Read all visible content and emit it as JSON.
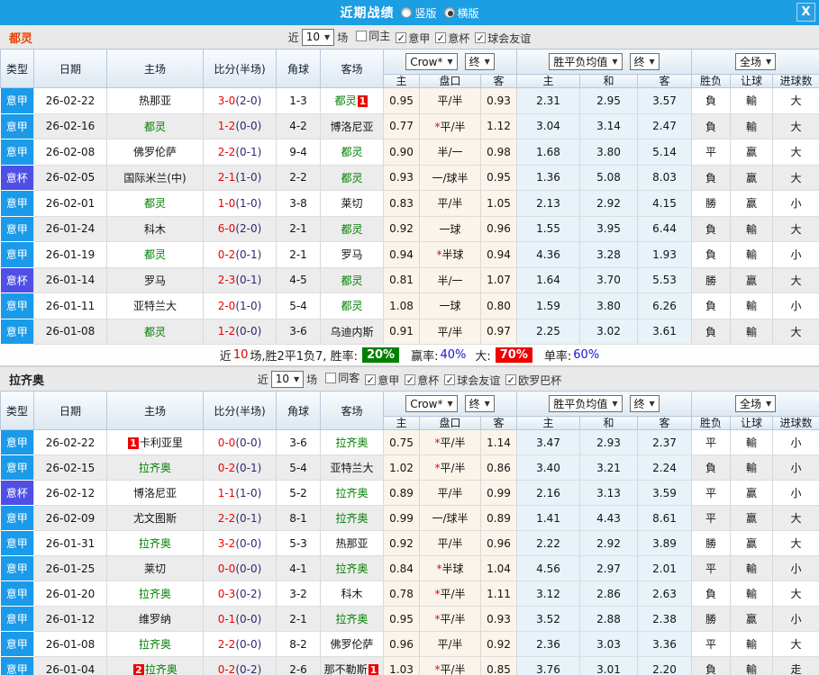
{
  "titlebar": {
    "title": "近期战绩",
    "vertical_label": "竖版",
    "vertical_selected": false,
    "horizontal_label": "横版",
    "horizontal_selected": true,
    "close_label": "X"
  },
  "columns": {
    "type": "类型",
    "date": "日期",
    "home": "主场",
    "score": "比分(半场)",
    "corners": "角球",
    "away": "客场",
    "odds_source": "Crow*",
    "final": "终",
    "avg_source": "胜平负均值",
    "scope": "全场",
    "home_odds": "主",
    "handicap": "盘口",
    "away_odds": "客",
    "avg_win": "主",
    "avg_draw": "和",
    "avg_lose": "客",
    "result": "胜负",
    "handicap_result": "让球",
    "goals": "进球数"
  },
  "colors": {
    "titlebar": "#1b9ee2",
    "league_badge": "#1a9ae8",
    "cup_badge": "#4f4fe6",
    "result_win": "#e00000",
    "result_draw": "#1616d0",
    "result_lose": "#008000",
    "score": "#f00000",
    "half_score": "#2a2a72",
    "focus_team": "#008000",
    "badge_red": "#ee0000",
    "odds_bg": "#faf4ea",
    "avg_bg": "#e7f2f9",
    "rate_win_bg": "#008000",
    "rate_over_bg": "#f00000"
  },
  "sections": [
    {
      "team": "都灵",
      "team_color": "#e84200",
      "filter": {
        "near_label": "近",
        "games": "10",
        "games_suffix": "场",
        "checkboxes": [
          {
            "name": "same-home",
            "label": "同主",
            "checked": false
          },
          {
            "name": "serie-a",
            "label": "意甲",
            "checked": true
          },
          {
            "name": "coppa-italia",
            "label": "意杯",
            "checked": true
          },
          {
            "name": "club-friendly",
            "label": "球会友谊",
            "checked": true
          }
        ]
      },
      "rows": [
        {
          "type": [
            "意甲",
            "league"
          ],
          "date": "26-02-22",
          "home": {
            "n": "热那亚"
          },
          "score": [
            "3-0",
            "(2-0)"
          ],
          "corner": "1-3",
          "away": {
            "n": "都灵",
            "g": true,
            "a": "1"
          },
          "odds": [
            "0.95",
            "平/半",
            "0.93"
          ],
          "avg": [
            "2.31",
            "2.95",
            "3.57"
          ],
          "res": [
            "負",
            "g"
          ],
          "let": [
            "輸",
            "g"
          ],
          "goal": [
            "大",
            "r"
          ]
        },
        {
          "type": [
            "意甲",
            "league"
          ],
          "date": "26-02-16",
          "home": {
            "n": "都灵",
            "g": true
          },
          "score": [
            "1-2",
            "(0-0)"
          ],
          "corner": "4-2",
          "away": {
            "n": "博洛尼亚"
          },
          "odds": [
            "0.77",
            "*平/半",
            "1.12"
          ],
          "avg": [
            "3.04",
            "3.14",
            "2.47"
          ],
          "res": [
            "負",
            "g"
          ],
          "let": [
            "輸",
            "g"
          ],
          "goal": [
            "大",
            "r"
          ]
        },
        {
          "type": [
            "意甲",
            "league"
          ],
          "date": "26-02-08",
          "home": {
            "n": "佛罗伦萨"
          },
          "score": [
            "2-2",
            "(0-1)"
          ],
          "corner": "9-4",
          "away": {
            "n": "都灵",
            "g": true
          },
          "odds": [
            "0.90",
            "半/一",
            "0.98"
          ],
          "avg": [
            "1.68",
            "3.80",
            "5.14"
          ],
          "res": [
            "平",
            "b"
          ],
          "let": [
            "赢",
            "r"
          ],
          "goal": [
            "大",
            "r"
          ]
        },
        {
          "type": [
            "意杯",
            "cup"
          ],
          "date": "26-02-05",
          "home": {
            "n": "国际米兰(中)"
          },
          "score": [
            "2-1",
            "(1-0)"
          ],
          "corner": "2-2",
          "away": {
            "n": "都灵",
            "g": true
          },
          "odds": [
            "0.93",
            "一/球半",
            "0.95"
          ],
          "avg": [
            "1.36",
            "5.08",
            "8.03"
          ],
          "res": [
            "負",
            "g"
          ],
          "let": [
            "赢",
            "r"
          ],
          "goal": [
            "大",
            "r"
          ]
        },
        {
          "type": [
            "意甲",
            "league"
          ],
          "date": "26-02-01",
          "home": {
            "n": "都灵",
            "g": true
          },
          "score": [
            "1-0",
            "(1-0)"
          ],
          "corner": "3-8",
          "away": {
            "n": "莱切"
          },
          "odds": [
            "0.83",
            "平/半",
            "1.05"
          ],
          "avg": [
            "2.13",
            "2.92",
            "4.15"
          ],
          "res": [
            "勝",
            "r"
          ],
          "let": [
            "赢",
            "r"
          ],
          "goal": [
            "小",
            "g"
          ]
        },
        {
          "type": [
            "意甲",
            "league"
          ],
          "date": "26-01-24",
          "home": {
            "n": "科木"
          },
          "score": [
            "6-0",
            "(2-0)"
          ],
          "corner": "2-1",
          "away": {
            "n": "都灵",
            "g": true
          },
          "odds": [
            "0.92",
            "一球",
            "0.96"
          ],
          "avg": [
            "1.55",
            "3.95",
            "6.44"
          ],
          "res": [
            "負",
            "g"
          ],
          "let": [
            "輸",
            "g"
          ],
          "goal": [
            "大",
            "r"
          ]
        },
        {
          "type": [
            "意甲",
            "league"
          ],
          "date": "26-01-19",
          "home": {
            "n": "都灵",
            "g": true
          },
          "score": [
            "0-2",
            "(0-1)"
          ],
          "corner": "2-1",
          "away": {
            "n": "罗马"
          },
          "odds": [
            "0.94",
            "*半球",
            "0.94"
          ],
          "avg": [
            "4.36",
            "3.28",
            "1.93"
          ],
          "res": [
            "負",
            "g"
          ],
          "let": [
            "輸",
            "g"
          ],
          "goal": [
            "小",
            "g"
          ]
        },
        {
          "type": [
            "意杯",
            "cup"
          ],
          "date": "26-01-14",
          "home": {
            "n": "罗马"
          },
          "score": [
            "2-3",
            "(0-1)"
          ],
          "corner": "4-5",
          "away": {
            "n": "都灵",
            "g": true
          },
          "odds": [
            "0.81",
            "半/一",
            "1.07"
          ],
          "avg": [
            "1.64",
            "3.70",
            "5.53"
          ],
          "res": [
            "勝",
            "r"
          ],
          "let": [
            "赢",
            "r"
          ],
          "goal": [
            "大",
            "r"
          ]
        },
        {
          "type": [
            "意甲",
            "league"
          ],
          "date": "26-01-11",
          "home": {
            "n": "亚特兰大"
          },
          "score": [
            "2-0",
            "(1-0)"
          ],
          "corner": "5-4",
          "away": {
            "n": "都灵",
            "g": true
          },
          "odds": [
            "1.08",
            "一球",
            "0.80"
          ],
          "avg": [
            "1.59",
            "3.80",
            "6.26"
          ],
          "res": [
            "負",
            "g"
          ],
          "let": [
            "輸",
            "g"
          ],
          "goal": [
            "小",
            "g"
          ]
        },
        {
          "type": [
            "意甲",
            "league"
          ],
          "date": "26-01-08",
          "home": {
            "n": "都灵",
            "g": true
          },
          "score": [
            "1-2",
            "(0-0)"
          ],
          "corner": "3-6",
          "away": {
            "n": "乌迪内斯"
          },
          "odds": [
            "0.91",
            "平/半",
            "0.97"
          ],
          "avg": [
            "2.25",
            "3.02",
            "3.61"
          ],
          "res": [
            "負",
            "g"
          ],
          "let": [
            "輸",
            "g"
          ],
          "goal": [
            "大",
            "r"
          ]
        }
      ],
      "summary": {
        "prefix": "近",
        "count": "10",
        "stats": "场,胜2平1负7, 胜率:",
        "win_rate": "20%",
        "label_win": "赢率:",
        "win_pct": "40%",
        "label_over": "大:",
        "over_rate": "70%",
        "label_single": "单率:",
        "single_pct": "60%"
      }
    },
    {
      "team": "拉齐奥",
      "team_color": "#222222",
      "filter": {
        "near_label": "近",
        "games": "10",
        "games_suffix": "场",
        "checkboxes": [
          {
            "name": "same-away",
            "label": "同客",
            "checked": false
          },
          {
            "name": "serie-a",
            "label": "意甲",
            "checked": true
          },
          {
            "name": "coppa-italia",
            "label": "意杯",
            "checked": true
          },
          {
            "name": "club-friendly",
            "label": "球会友谊",
            "checked": true
          },
          {
            "name": "europa-league",
            "label": "欧罗巴杯",
            "checked": true
          }
        ]
      },
      "rows": [
        {
          "type": [
            "意甲",
            "league"
          ],
          "date": "26-02-22",
          "home": {
            "n": "卡利亚里",
            "b": "1"
          },
          "score": [
            "0-0",
            "(0-0)"
          ],
          "corner": "3-6",
          "away": {
            "n": "拉齐奥",
            "g": true
          },
          "odds": [
            "0.75",
            "*平/半",
            "1.14"
          ],
          "avg": [
            "3.47",
            "2.93",
            "2.37"
          ],
          "res": [
            "平",
            "b"
          ],
          "let": [
            "輸",
            "g"
          ],
          "goal": [
            "小",
            "g"
          ]
        },
        {
          "type": [
            "意甲",
            "league"
          ],
          "date": "26-02-15",
          "home": {
            "n": "拉齐奥",
            "g": true
          },
          "score": [
            "0-2",
            "(0-1)"
          ],
          "corner": "5-4",
          "away": {
            "n": "亚特兰大"
          },
          "odds": [
            "1.02",
            "*平/半",
            "0.86"
          ],
          "avg": [
            "3.40",
            "3.21",
            "2.24"
          ],
          "res": [
            "負",
            "g"
          ],
          "let": [
            "輸",
            "g"
          ],
          "goal": [
            "小",
            "g"
          ]
        },
        {
          "type": [
            "意杯",
            "cup"
          ],
          "date": "26-02-12",
          "home": {
            "n": "博洛尼亚"
          },
          "score": [
            "1-1",
            "(1-0)"
          ],
          "corner": "5-2",
          "away": {
            "n": "拉齐奥",
            "g": true
          },
          "odds": [
            "0.89",
            "平/半",
            "0.99"
          ],
          "avg": [
            "2.16",
            "3.13",
            "3.59"
          ],
          "res": [
            "平",
            "b"
          ],
          "let": [
            "赢",
            "r"
          ],
          "goal": [
            "小",
            "g"
          ]
        },
        {
          "type": [
            "意甲",
            "league"
          ],
          "date": "26-02-09",
          "home": {
            "n": "尤文图斯"
          },
          "score": [
            "2-2",
            "(0-1)"
          ],
          "corner": "8-1",
          "away": {
            "n": "拉齐奥",
            "g": true
          },
          "odds": [
            "0.99",
            "一/球半",
            "0.89"
          ],
          "avg": [
            "1.41",
            "4.43",
            "8.61"
          ],
          "res": [
            "平",
            "b"
          ],
          "let": [
            "赢",
            "r"
          ],
          "goal": [
            "大",
            "r"
          ]
        },
        {
          "type": [
            "意甲",
            "league"
          ],
          "date": "26-01-31",
          "home": {
            "n": "拉齐奥",
            "g": true
          },
          "score": [
            "3-2",
            "(0-0)"
          ],
          "corner": "5-3",
          "away": {
            "n": "热那亚"
          },
          "odds": [
            "0.92",
            "平/半",
            "0.96"
          ],
          "avg": [
            "2.22",
            "2.92",
            "3.89"
          ],
          "res": [
            "勝",
            "r"
          ],
          "let": [
            "赢",
            "r"
          ],
          "goal": [
            "大",
            "r"
          ]
        },
        {
          "type": [
            "意甲",
            "league"
          ],
          "date": "26-01-25",
          "home": {
            "n": "莱切"
          },
          "score": [
            "0-0",
            "(0-0)"
          ],
          "corner": "4-1",
          "away": {
            "n": "拉齐奥",
            "g": true
          },
          "odds": [
            "0.84",
            "*半球",
            "1.04"
          ],
          "avg": [
            "4.56",
            "2.97",
            "2.01"
          ],
          "res": [
            "平",
            "b"
          ],
          "let": [
            "輸",
            "g"
          ],
          "goal": [
            "小",
            "g"
          ]
        },
        {
          "type": [
            "意甲",
            "league"
          ],
          "date": "26-01-20",
          "home": {
            "n": "拉齐奥",
            "g": true
          },
          "score": [
            "0-3",
            "(0-2)"
          ],
          "corner": "3-2",
          "away": {
            "n": "科木"
          },
          "odds": [
            "0.78",
            "*平/半",
            "1.11"
          ],
          "avg": [
            "3.12",
            "2.86",
            "2.63"
          ],
          "res": [
            "負",
            "g"
          ],
          "let": [
            "輸",
            "g"
          ],
          "goal": [
            "大",
            "r"
          ]
        },
        {
          "type": [
            "意甲",
            "league"
          ],
          "date": "26-01-12",
          "home": {
            "n": "维罗纳"
          },
          "score": [
            "0-1",
            "(0-0)"
          ],
          "corner": "2-1",
          "away": {
            "n": "拉齐奥",
            "g": true
          },
          "odds": [
            "0.95",
            "*平/半",
            "0.93"
          ],
          "avg": [
            "3.52",
            "2.88",
            "2.38"
          ],
          "res": [
            "勝",
            "r"
          ],
          "let": [
            "赢",
            "r"
          ],
          "goal": [
            "小",
            "g"
          ]
        },
        {
          "type": [
            "意甲",
            "league"
          ],
          "date": "26-01-08",
          "home": {
            "n": "拉齐奥",
            "g": true
          },
          "score": [
            "2-2",
            "(0-0)"
          ],
          "corner": "8-2",
          "away": {
            "n": "佛罗伦萨"
          },
          "odds": [
            "0.96",
            "平/半",
            "0.92"
          ],
          "avg": [
            "2.36",
            "3.03",
            "3.36"
          ],
          "res": [
            "平",
            "b"
          ],
          "let": [
            "輸",
            "g"
          ],
          "goal": [
            "大",
            "r"
          ]
        },
        {
          "type": [
            "意甲",
            "league"
          ],
          "date": "26-01-04",
          "home": {
            "n": "拉齐奥",
            "g": true,
            "b": "2"
          },
          "score": [
            "0-2",
            "(0-2)"
          ],
          "corner": "2-6",
          "away": {
            "n": "那不勒斯",
            "a": "1"
          },
          "odds": [
            "1.03",
            "*平/半",
            "0.85"
          ],
          "avg": [
            "3.76",
            "3.01",
            "2.20"
          ],
          "res": [
            "負",
            "g"
          ],
          "let": [
            "輸",
            "g"
          ],
          "goal": [
            "走",
            "b"
          ]
        }
      ]
    }
  ]
}
